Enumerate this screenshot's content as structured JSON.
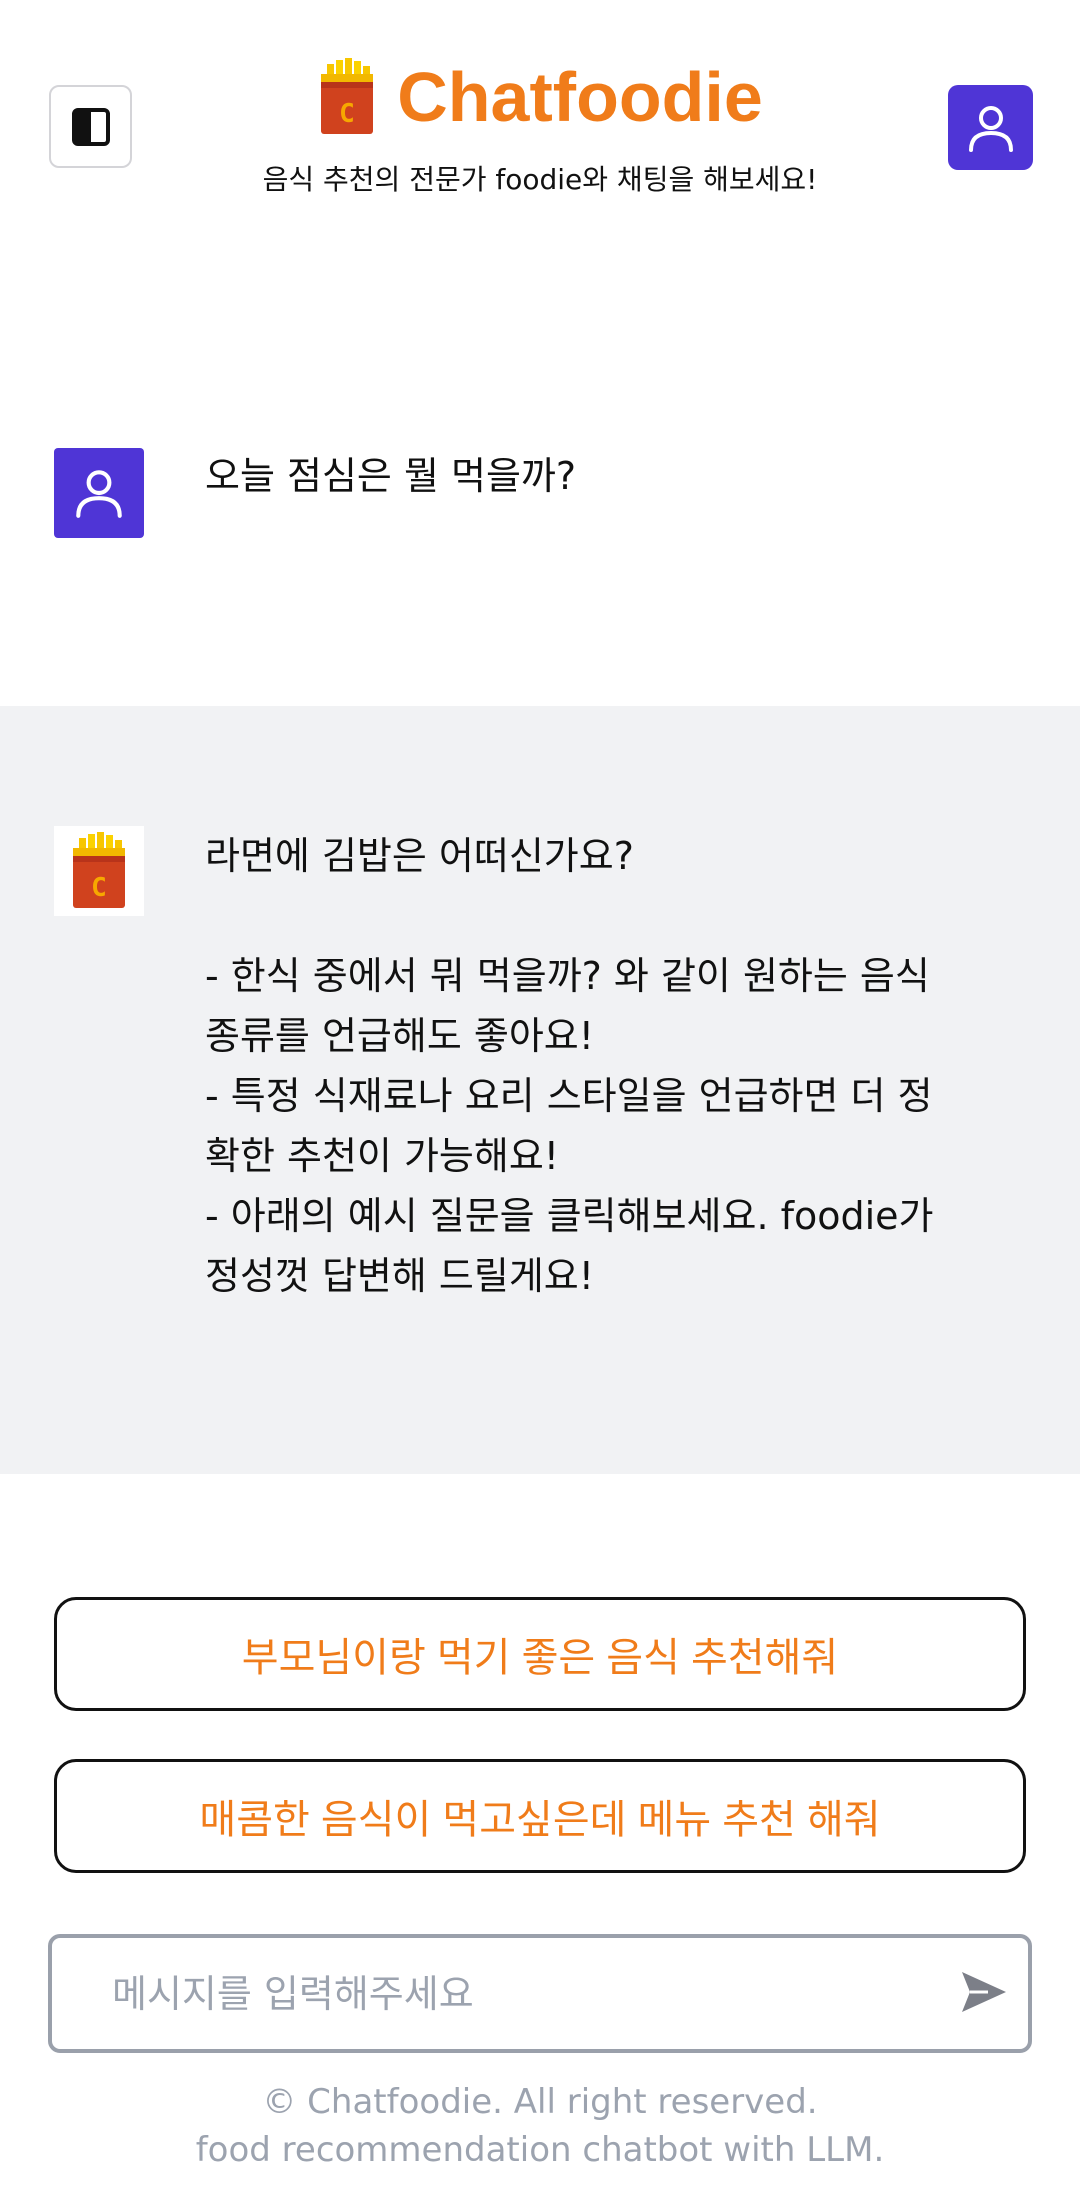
{
  "header": {
    "title": "Chatfoodie",
    "subtitle": "음식 추천의 전문가 foodie와 채팅을 해보세요!",
    "brand_color": "#f07c1a",
    "accent_color": "#4f35d6",
    "sidebar_toggle_icon": "sidebar-toggle-icon",
    "profile_icon": "user-icon"
  },
  "conversation": {
    "user_message": "오늘 점심은 뭘 먹을까?",
    "bot_message": {
      "lines": [
        "라면에 김밥은 어떠신가요?",
        "",
        "- 한식 중에서 뭐 먹을까? 와 같이 원하는 음식",
        "종류를 언급해도 좋아요!",
        "- 특정 식재료나 요리 스타일을 언급하면 더 정",
        "확한 추천이 가능해요!",
        "- 아래의 예시 질문을 클릭해보세요. foodie가",
        "정성껏 답변해 드릴게요!"
      ]
    }
  },
  "suggestions": [
    "부모님이랑 먹기 좋은 음식 추천해줘",
    "매콤한 음식이 먹고싶은데 메뉴 추천 해줘"
  ],
  "composer": {
    "placeholder": "메시지를 입력해주세요",
    "value": "",
    "send_icon": "send-icon"
  },
  "footer": {
    "line1": "© Chatfoodie. All right reserved.",
    "line2": "food recommendation chatbot with LLM."
  }
}
